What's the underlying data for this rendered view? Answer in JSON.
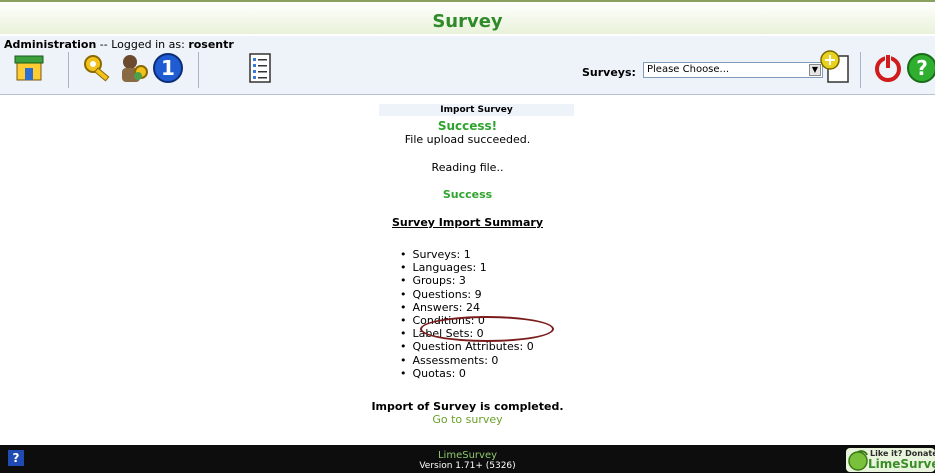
{
  "header": {
    "title": "Survey"
  },
  "admin": {
    "label": "Administration",
    "logged_in_text": " -- Logged in as: ",
    "user": "rosentr",
    "icons": [
      {
        "name": "home-icon"
      },
      {
        "name": "security-key-icon"
      },
      {
        "name": "users-key-icon"
      },
      {
        "name": "info-icon"
      },
      {
        "name": "survey-list-icon"
      }
    ],
    "surveys_label": "Surveys:",
    "surveys_select": "Please Choose...",
    "right_icons": [
      {
        "name": "new-survey-icon"
      },
      {
        "name": "logout-icon"
      },
      {
        "name": "help-icon"
      }
    ]
  },
  "import": {
    "panel_title": "Import Survey",
    "success_heading": "Success!",
    "upload_msg": "File upload succeeded.",
    "reading_msg": "Reading file..",
    "success2": "Success",
    "summary_title": "Survey Import Summary",
    "summary": [
      "Surveys: 1",
      "Languages: 1",
      "Groups: 3",
      "Questions: 9",
      "Answers: 24",
      "Conditions: 0",
      "Label Sets: 0",
      "Question Attributes: 0",
      "Assessments: 0",
      "Quotas: 0"
    ],
    "completed_msg": "Import of Survey is completed.",
    "go_link": "Go to survey"
  },
  "footer": {
    "help": "?",
    "brand": "LimeSurvey",
    "version": "Version 1.71+ (5326)",
    "donate_line1": "Like it? Donate to",
    "donate_line2": "LimeSurvey"
  }
}
